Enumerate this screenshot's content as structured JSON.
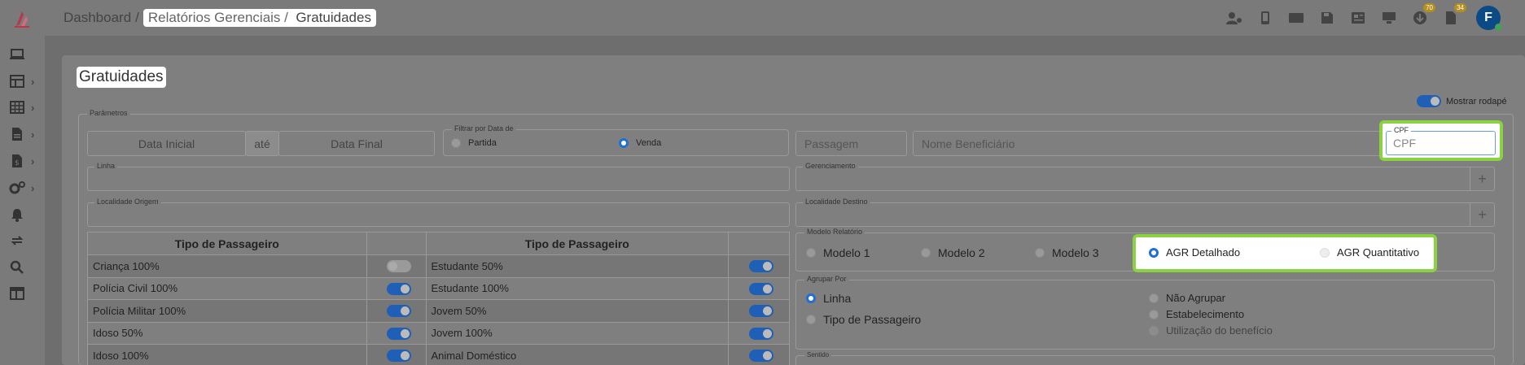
{
  "breadcrumb": {
    "home": "Dashboard",
    "sep": "/",
    "section": "Relatórios Gerenciais /",
    "current": "Gratuidades"
  },
  "topbar": {
    "avatar_letter": "F",
    "badge_downloads": "70",
    "badge_docs": "34"
  },
  "page": {
    "title": "Gratuidades",
    "mostrar_rodape": "Mostrar rodapé"
  },
  "params": {
    "legend": "Parâmetros",
    "data_inicial": "Data Inicial",
    "ate": "até",
    "data_final": "Data Final",
    "filtrar_legend": "Filtrar por Data de",
    "partida": "Partida",
    "venda": "Venda",
    "passagem": "Passagem",
    "nome_beneficiario": "Nome Beneficiário",
    "cpf_label": "CPF",
    "cpf_placeholder": "CPF",
    "linha": "Linha",
    "gerenciamento": "Gerenciamento",
    "localidade_origem": "Localidade Origem",
    "localidade_destino": "Localidade Destino",
    "plus": "+"
  },
  "table": {
    "header_left": "Tipo de Passageiro",
    "header_right": "Tipo de Passageiro",
    "rows": [
      {
        "left": "Criança 100%",
        "left_on": false,
        "right": "Estudante 50%",
        "right_on": true
      },
      {
        "left": "Polícia Civil 100%",
        "left_on": true,
        "right": "Estudante 100%",
        "right_on": true
      },
      {
        "left": "Polícia Militar 100%",
        "left_on": true,
        "right": "Jovem 50%",
        "right_on": true
      },
      {
        "left": "Idoso 50%",
        "left_on": true,
        "right": "Jovem 100%",
        "right_on": true
      },
      {
        "left": "Idoso 100%",
        "left_on": true,
        "right": "Animal Doméstico",
        "right_on": true
      }
    ]
  },
  "modelo": {
    "legend": "Modelo Relatório",
    "m1": "Modelo 1",
    "m2": "Modelo 2",
    "m3": "Modelo 3",
    "agr_detalhado": "AGR Detalhado",
    "agr_quantitativo": "AGR Quantitativo"
  },
  "agrupar": {
    "legend": "Agrupar Por",
    "linha": "Linha",
    "tipo_passageiro": "Tipo de Passageiro",
    "nao_agrupar": "Não Agrupar",
    "estabelecimento": "Estabelecimento",
    "utilizacao": "Utilização do benefício"
  },
  "sentido": {
    "legend": "Sentido"
  },
  "colors": {
    "accent": "#1f6fd6",
    "highlight": "#8ad23f",
    "brand": "#c0392b",
    "avatar": "#0c4a85"
  }
}
